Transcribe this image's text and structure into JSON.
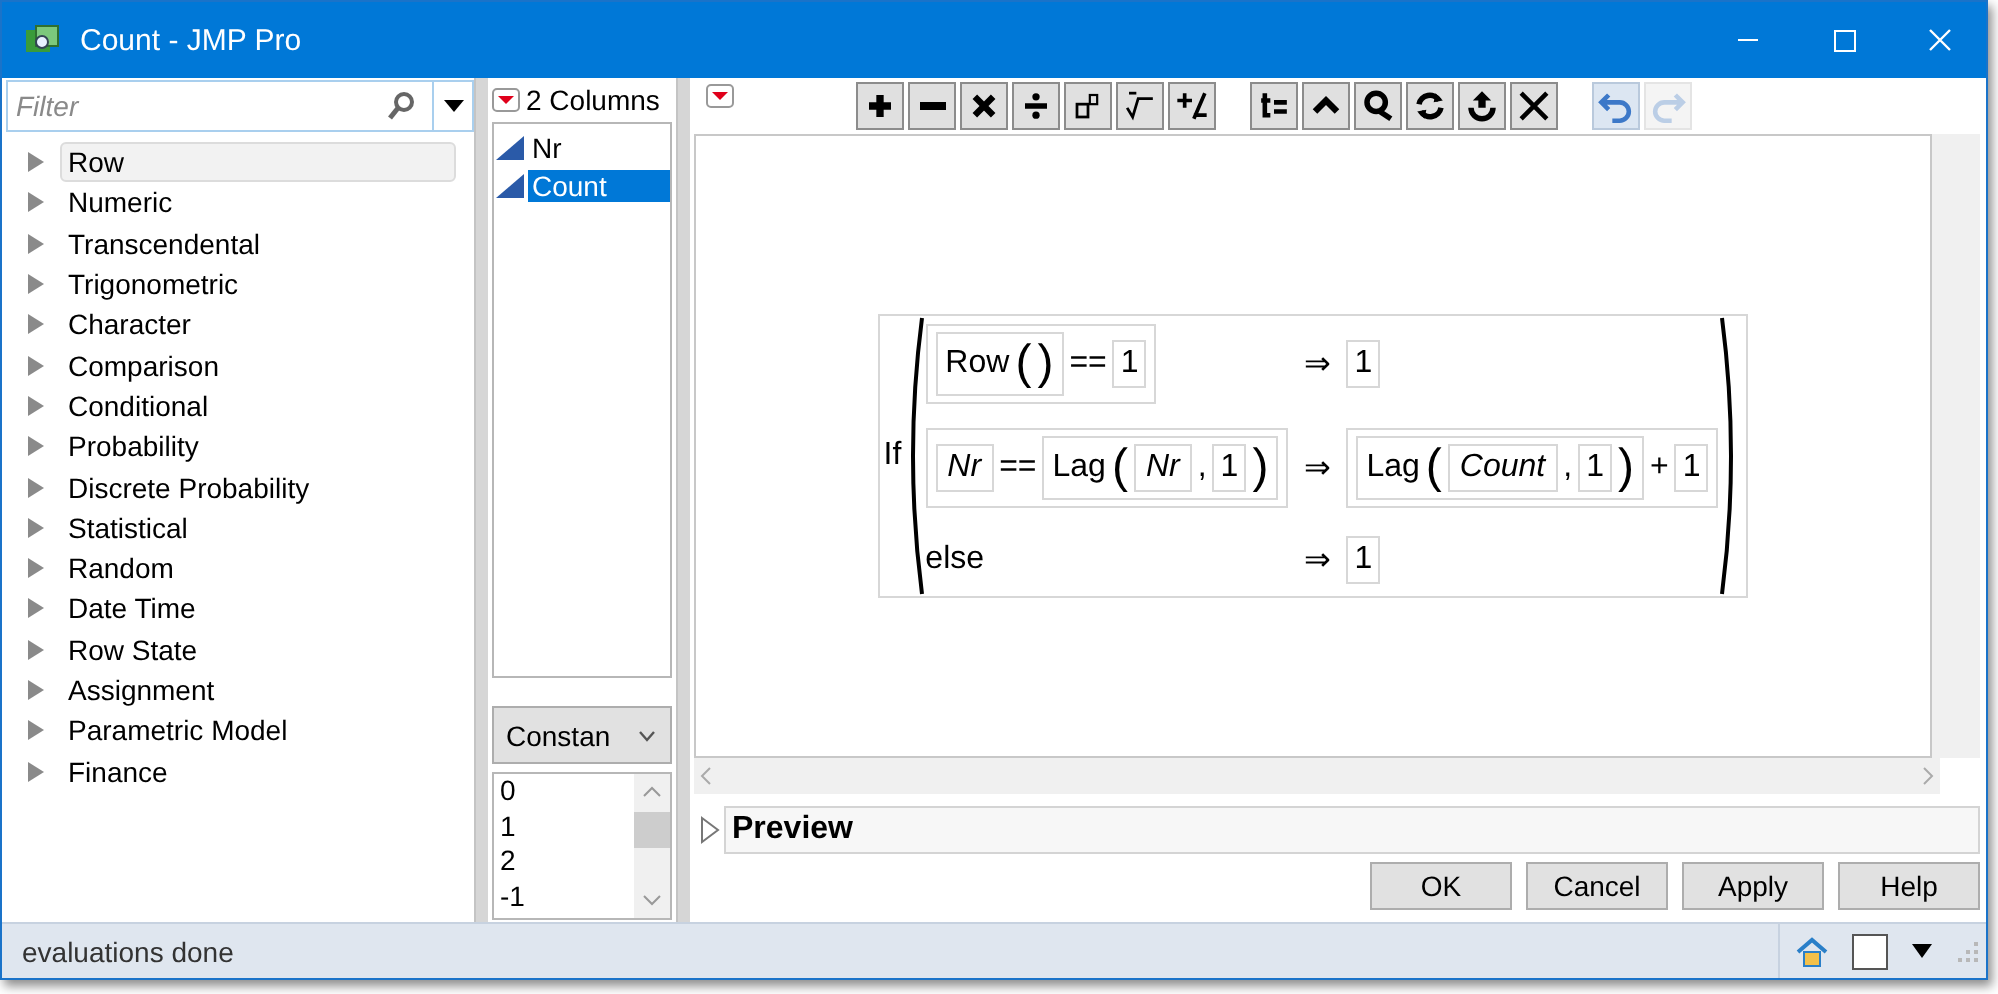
{
  "window": {
    "title": "Count - JMP Pro"
  },
  "filter": {
    "placeholder": "Filter"
  },
  "functions": [
    {
      "label": "Row",
      "selected": true
    },
    {
      "label": "Numeric",
      "selected": false
    },
    {
      "label": "Transcendental",
      "selected": false
    },
    {
      "label": "Trigonometric",
      "selected": false
    },
    {
      "label": "Character",
      "selected": false
    },
    {
      "label": "Comparison",
      "selected": false
    },
    {
      "label": "Conditional",
      "selected": false
    },
    {
      "label": "Probability",
      "selected": false
    },
    {
      "label": "Discrete Probability",
      "selected": false
    },
    {
      "label": "Statistical",
      "selected": false
    },
    {
      "label": "Random",
      "selected": false
    },
    {
      "label": "Date Time",
      "selected": false
    },
    {
      "label": "Row State",
      "selected": false
    },
    {
      "label": "Assignment",
      "selected": false
    },
    {
      "label": "Parametric Model",
      "selected": false
    },
    {
      "label": "Finance",
      "selected": false
    }
  ],
  "columns_panel": {
    "title": "2 Columns",
    "columns": [
      {
        "name": "Nr",
        "selected": false
      },
      {
        "name": "Count",
        "selected": true
      }
    ]
  },
  "constants": {
    "dropdown": "Constan",
    "values": [
      "0",
      "1",
      "2",
      "-1"
    ]
  },
  "toolbar": [
    {
      "disabled": false
    },
    {
      "disabled": false
    },
    {
      "disabled": false
    },
    {
      "disabled": false
    },
    {
      "disabled": false
    },
    {
      "disabled": false
    },
    {
      "disabled": false
    },
    {
      "disabled": false
    },
    {
      "disabled": false
    },
    {
      "disabled": false
    },
    {
      "disabled": false
    },
    {
      "disabled": false
    },
    {
      "disabled": false
    },
    {
      "disabled": false
    },
    {
      "disabled": true
    }
  ],
  "formula": {
    "name": "If",
    "clauses": [
      {
        "condition": [
          {
            "kind": "call",
            "name": "Row",
            "open": "(",
            "close": ")"
          },
          {
            "kind": "op",
            "text": "=="
          },
          {
            "kind": "num",
            "text": "1"
          }
        ],
        "arrow": "⇒",
        "result": [
          {
            "kind": "num",
            "text": "1"
          }
        ]
      },
      {
        "condition": [
          {
            "kind": "col",
            "text": "Nr"
          },
          {
            "kind": "op",
            "text": "=="
          },
          {
            "kind": "call",
            "name": "Lag",
            "open": "(",
            "close": ")",
            "sep": ",",
            "args": [
              {
                "kind": "col",
                "text": "Nr"
              },
              {
                "kind": "num",
                "text": "1"
              }
            ]
          }
        ],
        "arrow": "⇒",
        "result": [
          {
            "kind": "call",
            "name": "Lag",
            "open": "(",
            "close": ")",
            "sep": ",",
            "args": [
              {
                "kind": "col",
                "text": "Count"
              },
              {
                "kind": "num",
                "text": "1"
              }
            ]
          },
          {
            "kind": "op",
            "text": "+"
          },
          {
            "kind": "num",
            "text": "1"
          }
        ]
      }
    ],
    "else": {
      "label": "else",
      "arrow": "⇒",
      "result": [
        {
          "kind": "num",
          "text": "1"
        }
      ]
    }
  },
  "preview": {
    "label": "Preview",
    "expanded": false
  },
  "buttons": [
    "OK",
    "Cancel",
    "Apply",
    "Help"
  ],
  "status_bar": {
    "text": "evaluations done"
  }
}
